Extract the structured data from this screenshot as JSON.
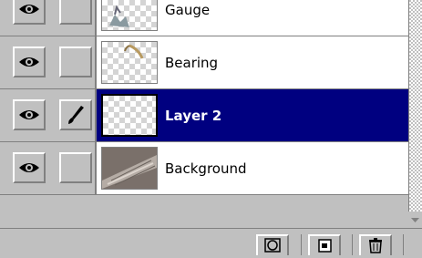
{
  "layers": [
    {
      "name": "Gauge",
      "visible_icon": "eye-icon",
      "brush_icon": "",
      "selected": false
    },
    {
      "name": "Bearing",
      "visible_icon": "eye-icon",
      "brush_icon": "",
      "selected": false
    },
    {
      "name": "Layer 2",
      "visible_icon": "eye-icon",
      "brush_icon": "paintbrush-icon",
      "selected": true
    },
    {
      "name": "Background",
      "visible_icon": "eye-icon",
      "brush_icon": "",
      "selected": false
    }
  ],
  "bottom_buttons": [
    "mask-icon",
    "new-layer-icon",
    "trash-icon"
  ],
  "colors": {
    "selection": "#000080",
    "panel": "#c0c0c0"
  }
}
